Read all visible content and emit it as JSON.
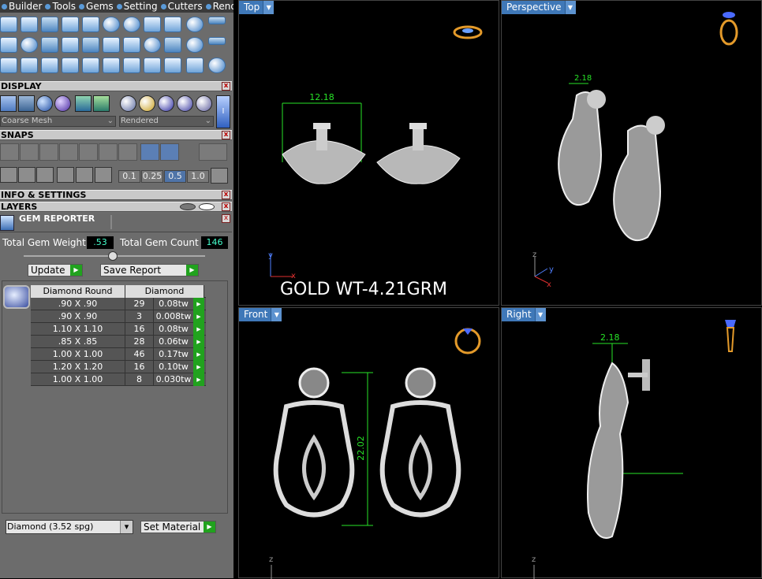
{
  "menu": [
    "Builder",
    "Tools",
    "Gems",
    "Setting",
    "Cutters",
    "Render"
  ],
  "panels": {
    "display": "DISPLAY",
    "snaps": "SNAPS",
    "info": "INFO & SETTINGS",
    "layers": "LAYERS",
    "close": "x"
  },
  "display": {
    "mesh_select": "Coarse Mesh",
    "render_select": "Rendered",
    "side_button": "I"
  },
  "snaps": {
    "values": [
      "0.1",
      "0.25",
      "0.5",
      "1.0"
    ]
  },
  "gem_reporter": {
    "title": "GEM REPORTER",
    "total_weight_label": "Total Gem Weight",
    "total_weight": ".53",
    "total_count_label": "Total Gem Count",
    "total_count": "146",
    "update_label": "Update",
    "save_label": "Save Report",
    "table": {
      "col1": "Diamond Round",
      "col2": "Diamond",
      "rows": [
        {
          "size": ".90 X .90",
          "count": "29",
          "weight": "0.08tw"
        },
        {
          "size": ".90 X .90",
          "count": "3",
          "weight": "0.008tw"
        },
        {
          "size": "1.10 X 1.10",
          "count": "16",
          "weight": "0.08tw"
        },
        {
          "size": ".85 X .85",
          "count": "28",
          "weight": "0.06tw"
        },
        {
          "size": "1.00 X 1.00",
          "count": "46",
          "weight": "0.17tw"
        },
        {
          "size": "1.20 X 1.20",
          "count": "16",
          "weight": "0.10tw"
        },
        {
          "size": "1.00 X 1.00",
          "count": "8",
          "weight": "0.030tw"
        }
      ]
    },
    "material_select": "Diamond      (3.52 spg)",
    "set_material_label": "Set Material"
  },
  "viewports": {
    "top": {
      "label": "Top",
      "dimension": "12.18",
      "axis_y": "y",
      "axis_x": "x"
    },
    "perspective": {
      "label": "Perspective",
      "dimension": "2.18",
      "axis_z": "z",
      "axis_y": "y",
      "axis_x": "x"
    },
    "front": {
      "label": "Front",
      "dimension": "22.02",
      "axis_z": "z"
    },
    "right": {
      "label": "Right",
      "dimension": "2.18",
      "axis_z": "z"
    }
  },
  "overlay_text": "GOLD WT-4.21GRM",
  "colors": {
    "viewport_label": "#3f78b8",
    "dimension": "#27e327",
    "go_button": "#21a21e",
    "axis_red": "#e03030",
    "axis_blue": "#5080ff"
  }
}
